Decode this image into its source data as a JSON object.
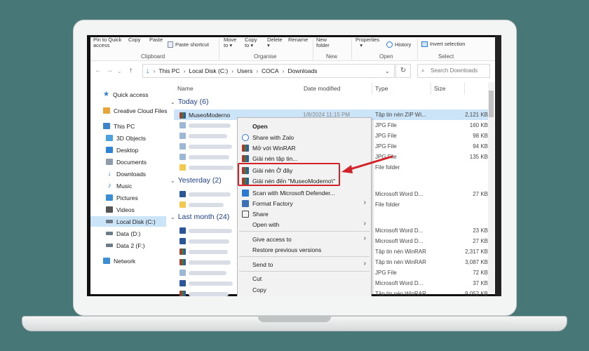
{
  "ribbon": {
    "pin_label": "Pin to Quick access",
    "copy_label": "Copy",
    "paste_label": "Paste",
    "paste_shortcut_label": "Paste shortcut",
    "clipboard_group": "Clipboard",
    "move_to_label": "Move to",
    "copy_to_label": "Copy to",
    "delete_label": "Delete",
    "rename_label": "Rename",
    "organise_group": "Organise",
    "new_folder_label": "New folder",
    "new_group": "New",
    "properties_label": "Properties",
    "history_label": "History",
    "open_group": "Open",
    "invert_selection_label": "Invert selection",
    "select_group": "Select"
  },
  "address": {
    "crumbs": [
      "This PC",
      "Local Disk (C:)",
      "Users",
      "COCA",
      "Downloads"
    ],
    "search_placeholder": "Search Downloads"
  },
  "sidebar": {
    "items": [
      {
        "label": "Quick access",
        "icon": "star-icon",
        "color": "#2a7ad5"
      },
      {
        "label": "Creative Cloud Files",
        "icon": "creative-cloud-icon",
        "color": "#e8a63a"
      },
      {
        "label": "This PC",
        "icon": "computer-icon",
        "color": "#3c83c9"
      },
      {
        "label": "3D Objects",
        "icon": "cube-icon",
        "color": "#4aa3df"
      },
      {
        "label": "Desktop",
        "icon": "desktop-icon",
        "color": "#2e84d8"
      },
      {
        "label": "Documents",
        "icon": "documents-icon",
        "color": "#8e9cae"
      },
      {
        "label": "Downloads",
        "icon": "download-arrow-icon",
        "color": "#2a7ad5"
      },
      {
        "label": "Music",
        "icon": "music-icon",
        "color": "#2a7ad5"
      },
      {
        "label": "Pictures",
        "icon": "pictures-icon",
        "color": "#3b8dd6"
      },
      {
        "label": "Videos",
        "icon": "videos-icon",
        "color": "#555555"
      },
      {
        "label": "Local Disk (C:)",
        "icon": "drive-icon",
        "color": "#6d7a88"
      },
      {
        "label": "Data (D:)",
        "icon": "drive-icon",
        "color": "#6d7a88"
      },
      {
        "label": "Data 2 (F:)",
        "icon": "drive-icon",
        "color": "#6d7a88"
      },
      {
        "label": "Network",
        "icon": "network-icon",
        "color": "#3b8dd6"
      }
    ]
  },
  "columns": {
    "name": "Name",
    "date": "Date modified",
    "type": "Type",
    "size": "Size"
  },
  "groups": {
    "today": "Today (6)",
    "yesterday": "Yesterday (2)",
    "last_month": "Last month (24)"
  },
  "files": {
    "selected_name": "MuseoModerno",
    "selected_date": "1/8/2024 11:15 PM",
    "today": [
      {
        "type": "Tập tin nén ZIP Wi...",
        "size": "2,121 KB"
      },
      {
        "type": "JPG File",
        "size": "160 KB"
      },
      {
        "type": "JPG File",
        "size": "98 KB"
      },
      {
        "type": "JPG File",
        "size": "94 KB"
      },
      {
        "type": "JPG File",
        "size": "135 KB"
      },
      {
        "type": "File folder",
        "size": ""
      }
    ],
    "yesterday": [
      {
        "type": "Microsoft Word D...",
        "size": "27 KB"
      },
      {
        "type": "File folder",
        "size": ""
      }
    ],
    "last_month": [
      {
        "type": "Microsoft Word D...",
        "size": "23 KB"
      },
      {
        "type": "Microsoft Word D...",
        "size": "27 KB"
      },
      {
        "type": "Tập tin nén WinRAR",
        "size": "2,317 KB"
      },
      {
        "type": "Tập tin nén WinRAR",
        "size": "3,087 KB"
      },
      {
        "type": "JPG File",
        "size": "72 KB"
      },
      {
        "type": "Microsoft Word D...",
        "size": "37 KB"
      },
      {
        "type": "Tập tin nén WinRAR",
        "size": "9,052 KB"
      }
    ]
  },
  "context_menu": {
    "open": "Open",
    "share_zalo": "Share with Zalo",
    "open_winrar": "Mở với WinRAR",
    "extract_files": "Giải nén tập tin...",
    "extract_here": "Giải nén Ở đây",
    "extract_to": "Giải nén đến \"MuseoModerno\\\"",
    "scan_defender": "Scan with Microsoft Defender...",
    "format_factory": "Format Factory",
    "share": "Share",
    "open_with": "Open with",
    "give_access": "Give access to",
    "restore_versions": "Restore previous versions",
    "send_to": "Send to",
    "cut": "Cut",
    "copy": "Copy"
  },
  "colors": {
    "background": "#477877",
    "highlight_box": "#d2232a",
    "selection": "#cce4f7",
    "group_header": "#1e3f8a"
  }
}
